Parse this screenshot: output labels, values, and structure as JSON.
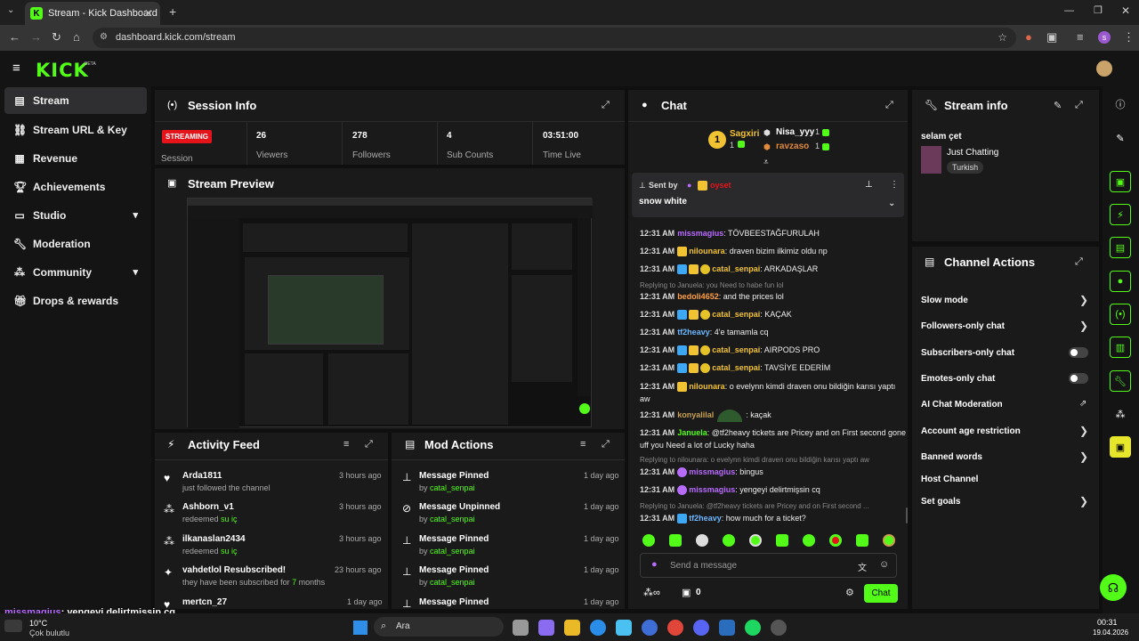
{
  "browser": {
    "tab_title": "Stream - Kick Dashboard",
    "url": "dashboard.kick.com/stream"
  },
  "header": {
    "logo": "KICK",
    "beta": "BETA"
  },
  "sidebar": {
    "items": [
      {
        "label": "Stream",
        "icon": "stream-icon"
      },
      {
        "label": "Stream URL & Key",
        "icon": "link-icon"
      },
      {
        "label": "Revenue",
        "icon": "revenue-icon"
      },
      {
        "label": "Achievements",
        "icon": "trophy-icon"
      },
      {
        "label": "Studio",
        "icon": "studio-icon"
      },
      {
        "label": "Moderation",
        "icon": "wrench-icon"
      },
      {
        "label": "Community",
        "icon": "community-icon"
      },
      {
        "label": "Drops & rewards",
        "icon": "gift-icon"
      }
    ]
  },
  "session": {
    "title": "Session Info",
    "status": "STREAMING",
    "status_label": "Session",
    "stats": [
      {
        "value": "26",
        "label": "Viewers"
      },
      {
        "value": "278",
        "label": "Followers"
      },
      {
        "value": "4",
        "label": "Sub Counts"
      },
      {
        "value": "03:51:00",
        "label": "Time Live"
      }
    ]
  },
  "preview": {
    "title": "Stream Preview"
  },
  "activity": {
    "title": "Activity Feed",
    "rows": [
      {
        "name": "Arda1811",
        "sub": "just followed the channel",
        "time": "3 hours ago"
      },
      {
        "name": "Ashborn_v1",
        "sub": "redeemed",
        "highlight": "su iç",
        "time": "3 hours ago"
      },
      {
        "name": "ilkanaslan2434",
        "sub": "redeemed",
        "highlight": "su iç",
        "time": "3 hours ago"
      },
      {
        "name": "vahdetlol Resubscribed!",
        "sub": "they have been subscribed for",
        "highlight": "7",
        "sub2": "months",
        "time": "23 hours ago"
      },
      {
        "name": "mertcn_27",
        "sub": "",
        "time": "1 day ago"
      }
    ]
  },
  "mod": {
    "title": "Mod Actions",
    "rows": [
      {
        "action": "Message Pinned",
        "by": "by",
        "user": "catal_senpai",
        "time": "1 day ago"
      },
      {
        "action": "Message Unpinned",
        "by": "by",
        "user": "catal_senpai",
        "time": "1 day ago"
      },
      {
        "action": "Message Pinned",
        "by": "by",
        "user": "catal_senpai",
        "time": "1 day ago"
      },
      {
        "action": "Message Pinned",
        "by": "by",
        "user": "catal_senpai",
        "time": "1 day ago"
      },
      {
        "action": "Message Pinned",
        "by": "",
        "user": "",
        "time": "1 day ago"
      }
    ]
  },
  "chat": {
    "title": "Chat",
    "gifters": [
      {
        "rank": "1",
        "name": "Sagxiri",
        "count": "1"
      },
      {
        "name": "Nisa_yyy",
        "count": "1"
      },
      {
        "name": "ravzaso",
        "count": "1"
      }
    ],
    "pinned": {
      "sent_by": "Sent by",
      "user": "oyset",
      "text": "snow white"
    },
    "messages": [
      {
        "time": "12:31 AM",
        "user": "missmagius",
        "color": "purple",
        "text": ": TÖVBEESTAĞFURULAH"
      },
      {
        "time": "12:31 AM",
        "user": "nilounara",
        "color": "yellow",
        "text": ": draven bizim ilkimiz oldu np"
      },
      {
        "time": "12:31 AM",
        "user": "catal_senpai",
        "color": "yellow",
        "text": ": ARKADAŞLAR"
      },
      {
        "reply": "Replying to Januela: you Need to habe fun lol"
      },
      {
        "time": "12:31 AM",
        "user": "bedoli4652",
        "color": "orange",
        "text": ": and the prices lol"
      },
      {
        "time": "12:31 AM",
        "user": "catal_senpai",
        "color": "yellow",
        "text": ": KAÇAK"
      },
      {
        "time": "12:31 AM",
        "user": "tf2heavy",
        "color": "blue",
        "text": ": 4'e tamamla cq"
      },
      {
        "time": "12:31 AM",
        "user": "catal_senpai",
        "color": "yellow",
        "text": ": AIRPODS PRO"
      },
      {
        "time": "12:31 AM",
        "user": "catal_senpai",
        "color": "yellow",
        "text": ": TAVSİYE EDERİM"
      },
      {
        "time": "12:31 AM",
        "user": "nilounara",
        "color": "yellow",
        "text": ": o evelynn kimdi draven onu bildiğin karısı yaptı aw"
      },
      {
        "time": "12:31 AM",
        "user": "konyalilal",
        "color": "brown",
        "text": ": kaçak"
      },
      {
        "time": "12:31 AM",
        "user": "Januela",
        "color": "green",
        "text": ": @tf2heavy tickets are Pricey and on First second gone uff you Need a lot of Lucky haha"
      },
      {
        "reply": "Replying to nilounara: o evelynn kimdi draven onu bildiğin karısı yaptı aw"
      },
      {
        "time": "12:31 AM",
        "user": "missmagius",
        "color": "purple",
        "text": ": bingus"
      },
      {
        "time": "12:31 AM",
        "user": "missmagius",
        "color": "purple",
        "text": ": yengeyi delirtmişsin cq"
      },
      {
        "reply": "Replying to Januela: @tf2heavy tickets are Pricey and on First second ..."
      },
      {
        "time": "12:31 AM",
        "user": "tf2heavy",
        "color": "blue",
        "text": ": how much for a ticket?"
      }
    ],
    "input_placeholder": "Send a message",
    "points": "0",
    "send_label": "Chat"
  },
  "stream_info": {
    "title": "Stream info",
    "stream_title": "selam çet",
    "category": "Just Chatting",
    "language": "Turkish"
  },
  "channel_actions": {
    "title": "Channel Actions",
    "items": [
      {
        "label": "Slow mode",
        "control": "chevron"
      },
      {
        "label": "Followers-only chat",
        "control": "chevron"
      },
      {
        "label": "Subscribers-only chat",
        "control": "toggle"
      },
      {
        "label": "Emotes-only chat",
        "control": "toggle"
      },
      {
        "label": "AI Chat Moderation",
        "control": "external"
      },
      {
        "label": "Account age restriction",
        "control": "chevron"
      },
      {
        "label": "Banned words",
        "control": "chevron"
      },
      {
        "label": "Host Channel",
        "control": "none"
      },
      {
        "label": "Set goals",
        "control": "chevron"
      }
    ]
  },
  "overlay": {
    "user": "missmagius",
    "text": ": yengeyi delirtmişsin cq"
  },
  "taskbar": {
    "weather_temp": "10°C",
    "weather_desc": "Çok bulutlu",
    "search": "Ara",
    "time": "00:31",
    "date": "19.04.2026"
  },
  "colors": {
    "accent": "#53fc18",
    "streaming": "#e5141b",
    "bg": "#0f0f10",
    "panel": "#1a1a1b"
  }
}
